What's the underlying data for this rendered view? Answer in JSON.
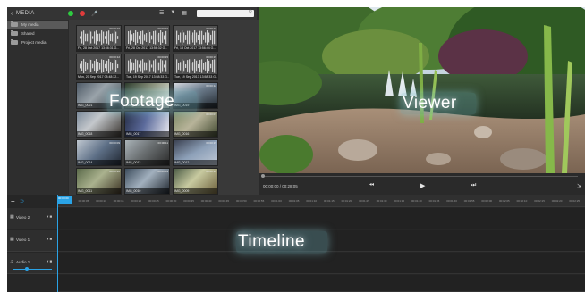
{
  "media": {
    "back_icon": "chevron-left-icon",
    "title": "MEDIA",
    "search": {
      "placeholder": ""
    },
    "sidebar": [
      {
        "label": "My media",
        "active": true
      },
      {
        "label": "Shared",
        "active": false
      },
      {
        "label": "Project media",
        "active": false
      }
    ]
  },
  "colors": {
    "accent": "#2aa3e6",
    "record_green": "#2ecc40",
    "record_red": "#e03b3b",
    "panel_bg": "#2b2b2b"
  },
  "clips": [
    {
      "type": "audio",
      "caption": "Fri, 28 Oct 2017 13:56:31 G...",
      "duration": "00:00:10"
    },
    {
      "type": "audio",
      "caption": "Fri, 28 Oct 2017 13:56:32 G...",
      "duration": "00:00:10"
    },
    {
      "type": "audio",
      "caption": "Fri, 13 Oct 2017 13:56:44 G...",
      "duration": "00:00:10"
    },
    {
      "type": "audio",
      "caption": "Mon, 20 Sep 2017 08:48:32...",
      "duration": "00:00:12"
    },
    {
      "type": "audio",
      "caption": "Tue, 19 Sep 2017 13:58:33 G...",
      "duration": "00:00:15"
    },
    {
      "type": "audio",
      "caption": "Tue, 19 Sep 2017 13:58:33 G...",
      "duration": "00:00:15"
    },
    {
      "type": "video",
      "caption": "IMG_0021",
      "duration": ""
    },
    {
      "type": "video",
      "caption": "IMG_0020",
      "duration": ""
    },
    {
      "type": "video",
      "caption": "IMG_0019",
      "duration": "00:00:12"
    },
    {
      "type": "video",
      "caption": "IMG_0018",
      "duration": ""
    },
    {
      "type": "video",
      "caption": "IMG_0017",
      "duration": ""
    },
    {
      "type": "video",
      "caption": "IMG_0016",
      "duration": "00:00:07"
    },
    {
      "type": "video",
      "caption": "IMG_0014",
      "duration": "00:00:09"
    },
    {
      "type": "video",
      "caption": "IMG_0013",
      "duration": "00:00:11"
    },
    {
      "type": "video",
      "caption": "IMG_0012",
      "duration": "00:00:15"
    },
    {
      "type": "video",
      "caption": "IMG_0011",
      "duration": "00:00:10"
    },
    {
      "type": "video",
      "caption": "IMG_0010",
      "duration": "00:00:09"
    },
    {
      "type": "video",
      "caption": "IMG_0009",
      "duration": "00:00:12"
    }
  ],
  "overlays": {
    "footage": "Footage",
    "viewer": "Viewer",
    "timeline": "Timeline"
  },
  "viewer": {
    "timecode": "00:00:00 / 00:28:05",
    "prev_icon": "skip-back-icon",
    "play_icon": "play-icon",
    "next_icon": "skip-forward-icon",
    "fullscreen_icon": "fullscreen-icon"
  },
  "timeline": {
    "playhead_label": "00:00:00",
    "ruler_ticks": [
      "00:00:00",
      "00:00:05",
      "00:00:10",
      "00:00:15",
      "00:00:20",
      "00:00:25",
      "00:00:30",
      "00:00:35",
      "00:00:40",
      "00:00:45",
      "00:00:50",
      "00:00:55",
      "00:01:00",
      "00:01:05",
      "00:01:10",
      "00:01:15",
      "00:01:20",
      "00:01:25",
      "00:01:30",
      "00:01:35",
      "00:01:40",
      "00:01:45",
      "00:01:50",
      "00:01:55",
      "00:02:00",
      "00:02:05",
      "00:02:10",
      "00:02:15",
      "00:02:20",
      "00:02:25"
    ],
    "tracks": [
      {
        "name": "Video 2",
        "icon": "video-track-icon"
      },
      {
        "name": "Video 1",
        "icon": "video-track-icon"
      },
      {
        "name": "Audio 1",
        "icon": "audio-track-icon"
      }
    ]
  }
}
